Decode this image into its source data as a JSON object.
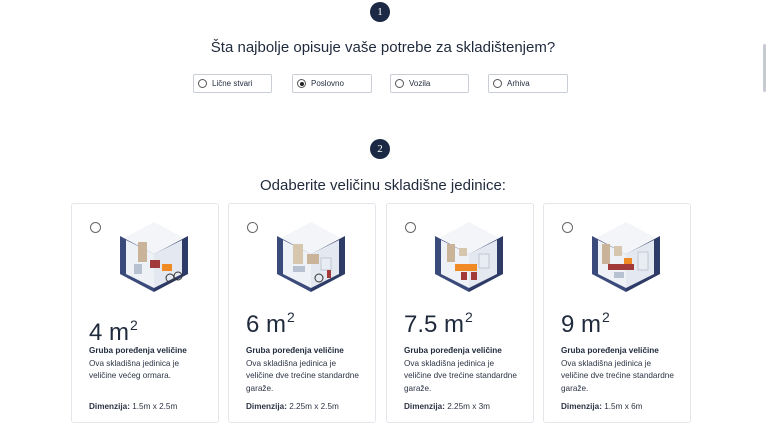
{
  "step1": {
    "badge": "1",
    "question": "Šta najbolje opisuje vaše potrebe za skladištenjem?"
  },
  "options": [
    {
      "label": "Lične stvari",
      "checked": false
    },
    {
      "label": "Poslovno",
      "checked": true
    },
    {
      "label": "Vozila",
      "checked": false
    },
    {
      "label": "Arhiva",
      "checked": false
    }
  ],
  "step2": {
    "badge": "2",
    "question": "Odaberite veličinu skladišne jedinice:"
  },
  "units": [
    {
      "size": "4 m",
      "sup": "2",
      "title": "Gruba poređenja veličine",
      "desc": "Ova skladišna jedinica je veličine većeg ormara.",
      "dim_label": "Dimenzija:",
      "dim_value": " 1.5m x 2.5m"
    },
    {
      "size": "6 m",
      "sup": "2",
      "title": "Gruba poređenja veličine",
      "desc": "Ova skladišna jedinica je veličine dve trećine standardne garaže.",
      "dim_label": "Dimenzija:",
      "dim_value": " 2.25m x 2.5m"
    },
    {
      "size": "7.5 m",
      "sup": "2",
      "title": "Gruba poređenja veličine",
      "desc": "Ova skladišna jedinica je veličine dve trećine standardne garaže.",
      "dim_label": "Dimenzija:",
      "dim_value": " 2.25m x 3m"
    },
    {
      "size": "9 m",
      "sup": "2",
      "title": "Gruba poređenja veličine",
      "desc": "Ova skladišna jedinica je veličine dve trećine standardne garaže.",
      "dim_label": "Dimenzija:",
      "dim_value": " 1.5m x 6m"
    }
  ],
  "colors": {
    "badge": "#1c2945",
    "wall": "#3a4a7a",
    "floor": "#e8ecf3",
    "accent_orange": "#f08a24",
    "accent_red": "#a33a3a"
  }
}
